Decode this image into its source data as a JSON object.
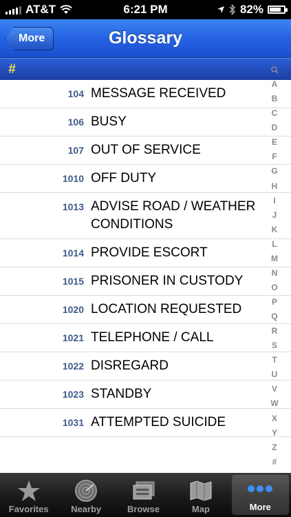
{
  "status_bar": {
    "carrier": "AT&T",
    "time": "6:21 PM",
    "battery_percent": "82%",
    "battery_level": 0.82
  },
  "nav": {
    "back_label": "More",
    "title": "Glossary"
  },
  "section": {
    "header": "#"
  },
  "items": [
    {
      "code": "104",
      "term": "MESSAGE RECEIVED"
    },
    {
      "code": "106",
      "term": "BUSY"
    },
    {
      "code": "107",
      "term": "OUT OF SERVICE"
    },
    {
      "code": "1010",
      "term": "OFF DUTY"
    },
    {
      "code": "1013",
      "term": "ADVISE ROAD / WEATHER CONDITIONS"
    },
    {
      "code": "1014",
      "term": "PROVIDE ESCORT"
    },
    {
      "code": "1015",
      "term": "PRISONER IN CUSTODY"
    },
    {
      "code": "1020",
      "term": "LOCATION REQUESTED"
    },
    {
      "code": "1021",
      "term": "TELEPHONE / CALL"
    },
    {
      "code": "1022",
      "term": "DISREGARD"
    },
    {
      "code": "1023",
      "term": "STANDBY"
    },
    {
      "code": "1031",
      "term": "ATTEMPTED SUICIDE"
    }
  ],
  "index_letters": [
    "A",
    "B",
    "C",
    "D",
    "E",
    "F",
    "G",
    "H",
    "I",
    "J",
    "K",
    "L",
    "M",
    "N",
    "O",
    "P",
    "Q",
    "R",
    "S",
    "T",
    "U",
    "V",
    "W",
    "X",
    "Y",
    "Z",
    "#"
  ],
  "tabs": [
    {
      "label": "Favorites",
      "icon": "star-icon"
    },
    {
      "label": "Nearby",
      "icon": "radar-icon"
    },
    {
      "label": "Browse",
      "icon": "browse-icon"
    },
    {
      "label": "Map",
      "icon": "map-icon"
    },
    {
      "label": "More",
      "icon": "more-icon",
      "active": true
    }
  ]
}
